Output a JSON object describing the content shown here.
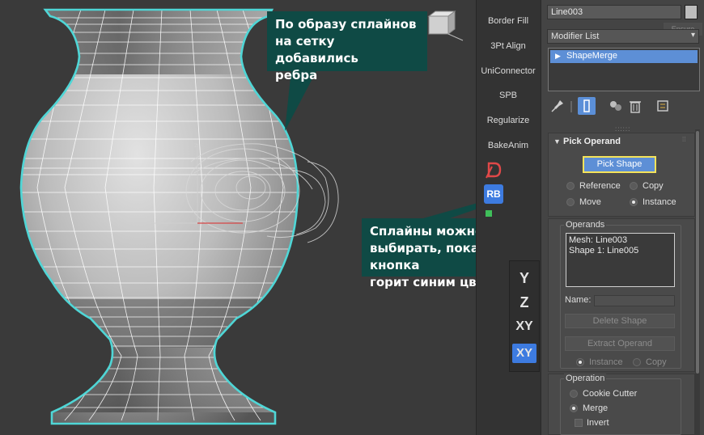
{
  "callouts": {
    "top": [
      "По образу сплайнов",
      "на сетку добавились",
      "ребра"
    ],
    "bottom": [
      "Сплайны можно",
      "выбирать, пока кнопка",
      "горит синим цветом"
    ]
  },
  "command_strip": {
    "buttons": [
      "Border Fill",
      "3Pt Align",
      "UniConnector",
      "SPB",
      "Regularize",
      "BakeAnim"
    ],
    "icons": {
      "rb": "RB"
    },
    "axes": [
      "Y",
      "Z",
      "XY",
      "XY"
    ]
  },
  "panel": {
    "object_name": "Line003",
    "modifier_list": "Modifier List",
    "ghost_button": "Ensure",
    "stack_item": "ShapeMerge",
    "pick_operand": {
      "title": "Pick Operand",
      "pick_button": "Pick Shape",
      "reference": "Reference",
      "copy": "Copy",
      "move": "Move",
      "instance": "Instance"
    },
    "operands": {
      "title": "Operands",
      "items": [
        "Mesh: Line003",
        "Shape 1: Line005"
      ],
      "name_label": "Name:",
      "delete_shape": "Delete Shape",
      "extract_operand": "Extract Operand",
      "instance": "Instance",
      "copy": "Copy"
    },
    "operation": {
      "title": "Operation",
      "cookie_cutter": "Cookie Cutter",
      "merge": "Merge",
      "invert": "Invert"
    }
  },
  "colors": {
    "wire_outline": "#4fd6d6",
    "callout_bg": "#0f4a45",
    "active_blue": "#5d8fd6",
    "highlight_yellow": "#f4e35a"
  }
}
